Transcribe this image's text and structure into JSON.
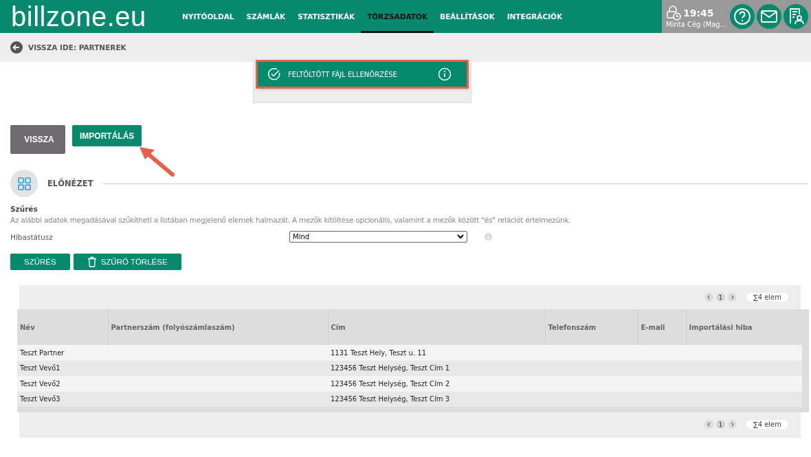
{
  "header": {
    "logo": "billzone.eu",
    "nav": [
      {
        "label": "NYITÓOLDAL",
        "selected": false
      },
      {
        "label": "SZÁMLÁK",
        "selected": false
      },
      {
        "label": "STATISZTIKÁK",
        "selected": false
      },
      {
        "label": "TÖRZSADATOK",
        "selected": true
      },
      {
        "label": "BEÁLLÍTÁSOK",
        "selected": false
      },
      {
        "label": "INTEGRÁCIÓK",
        "selected": false
      }
    ],
    "time": "19:45",
    "company": "Minta Cég (Mag..."
  },
  "breadcrumb": "VISSZA IDE: PARTNEREK",
  "step": {
    "label": "FELTÖLTÖTT FÁJL ELLENŐRZÉSE",
    "highlighted": true
  },
  "actions": [
    {
      "label": "VISSZA",
      "kind": "secondary"
    },
    {
      "label": "IMPORTÁLÁS",
      "kind": "primary"
    }
  ],
  "section_title": "ELŐNÉZET",
  "filter": {
    "title": "Szűrés",
    "description": "Az alábbi adatok megadásával szűkítheti a listában megjelenő elemek halmazát. A mezők kitöltése opcionális, valamint a mezők között \"és\" relációt értelmezünk.",
    "field_label": "Hibastátusz",
    "field_value": "Mind",
    "buttons": [
      {
        "label": "SZŰRÉS",
        "kind": "plain"
      },
      {
        "label": "SZŰRŐ TÖRLÉSE",
        "kind": "trash"
      }
    ]
  },
  "pager_top": {
    "pages": [
      {
        "label": "1",
        "selected": true
      }
    ],
    "count": "∑4 elem"
  },
  "table": {
    "columns": [
      "Név",
      "Partnerszám (folyószámlaszám)",
      "Cím",
      "Telefonszám",
      "E-mail",
      "Importálási hiba"
    ],
    "rows": [
      [
        "Teszt Partner",
        "",
        "1131 Teszt Hely, Teszt u. 11",
        "",
        "",
        ""
      ],
      [
        "Teszt Vevő1",
        "",
        "123456 Teszt Helység, Teszt Cím 1",
        "",
        "",
        ""
      ],
      [
        "Teszt Vevő2",
        "",
        "123456 Teszt Helység, Teszt Cím 2",
        "",
        "",
        ""
      ],
      [
        "Teszt Vevő3",
        "",
        "123456 Teszt Helység, Teszt Cím 3",
        "",
        "",
        ""
      ]
    ]
  },
  "pager_bottom": {
    "pages": [
      {
        "label": "1",
        "selected": true
      }
    ],
    "count": "∑4 elem"
  }
}
